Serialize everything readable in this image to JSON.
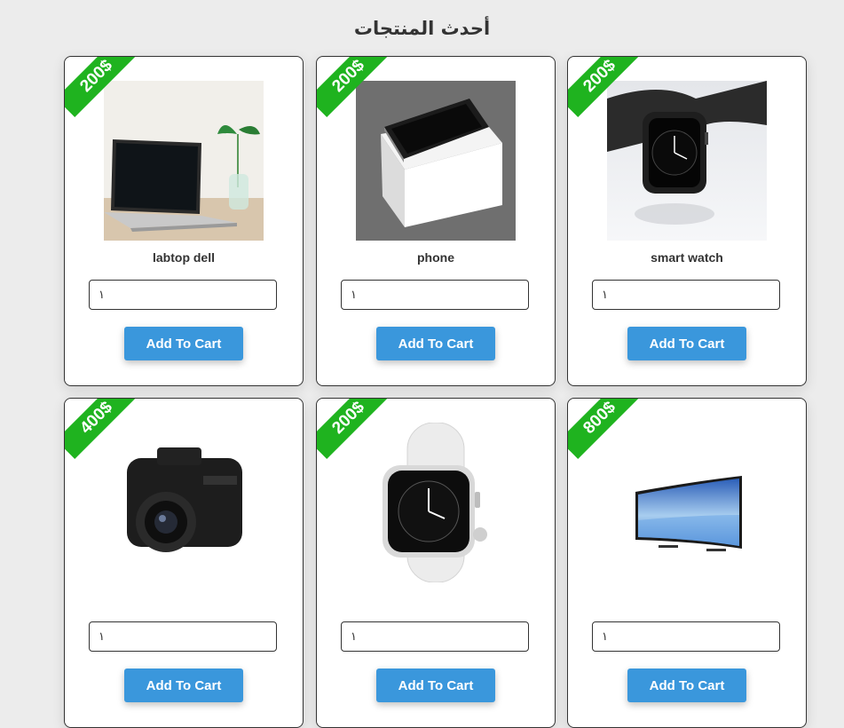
{
  "page": {
    "title": "أحدث المنتجات"
  },
  "products": [
    {
      "price": "200$",
      "name": "labtop dell",
      "quantity": "١",
      "button": "Add To Cart",
      "icon": "laptop-image"
    },
    {
      "price": "200$",
      "name": "phone",
      "quantity": "١",
      "button": "Add To Cart",
      "icon": "phone-image"
    },
    {
      "price": "200$",
      "name": "smart watch",
      "quantity": "١",
      "button": "Add To Cart",
      "icon": "smartwatch-image"
    },
    {
      "price": "400$",
      "name": "",
      "quantity": "١",
      "button": "Add To Cart",
      "icon": "camera-image"
    },
    {
      "price": "200$",
      "name": "",
      "quantity": "١",
      "button": "Add To Cart",
      "icon": "white-watch-image"
    },
    {
      "price": "800$",
      "name": "",
      "quantity": "١",
      "button": "Add To Cart",
      "icon": "tv-image"
    }
  ],
  "colors": {
    "badge": "#1fb31f",
    "button": "#3a97dc",
    "background": "#ececec"
  }
}
